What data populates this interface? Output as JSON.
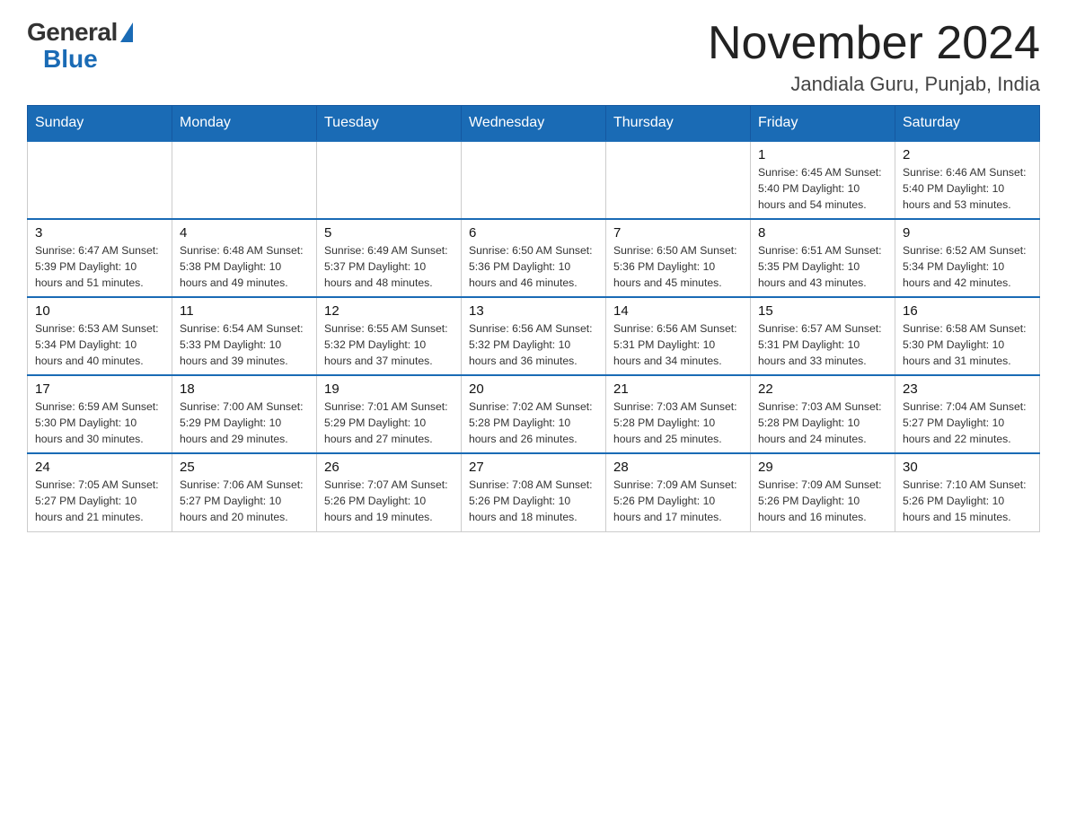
{
  "logo": {
    "general": "General",
    "blue": "Blue"
  },
  "title": "November 2024",
  "subtitle": "Jandiala Guru, Punjab, India",
  "weekdays": [
    "Sunday",
    "Monday",
    "Tuesday",
    "Wednesday",
    "Thursday",
    "Friday",
    "Saturday"
  ],
  "weeks": [
    [
      {
        "day": "",
        "info": ""
      },
      {
        "day": "",
        "info": ""
      },
      {
        "day": "",
        "info": ""
      },
      {
        "day": "",
        "info": ""
      },
      {
        "day": "",
        "info": ""
      },
      {
        "day": "1",
        "info": "Sunrise: 6:45 AM\nSunset: 5:40 PM\nDaylight: 10 hours\nand 54 minutes."
      },
      {
        "day": "2",
        "info": "Sunrise: 6:46 AM\nSunset: 5:40 PM\nDaylight: 10 hours\nand 53 minutes."
      }
    ],
    [
      {
        "day": "3",
        "info": "Sunrise: 6:47 AM\nSunset: 5:39 PM\nDaylight: 10 hours\nand 51 minutes."
      },
      {
        "day": "4",
        "info": "Sunrise: 6:48 AM\nSunset: 5:38 PM\nDaylight: 10 hours\nand 49 minutes."
      },
      {
        "day": "5",
        "info": "Sunrise: 6:49 AM\nSunset: 5:37 PM\nDaylight: 10 hours\nand 48 minutes."
      },
      {
        "day": "6",
        "info": "Sunrise: 6:50 AM\nSunset: 5:36 PM\nDaylight: 10 hours\nand 46 minutes."
      },
      {
        "day": "7",
        "info": "Sunrise: 6:50 AM\nSunset: 5:36 PM\nDaylight: 10 hours\nand 45 minutes."
      },
      {
        "day": "8",
        "info": "Sunrise: 6:51 AM\nSunset: 5:35 PM\nDaylight: 10 hours\nand 43 minutes."
      },
      {
        "day": "9",
        "info": "Sunrise: 6:52 AM\nSunset: 5:34 PM\nDaylight: 10 hours\nand 42 minutes."
      }
    ],
    [
      {
        "day": "10",
        "info": "Sunrise: 6:53 AM\nSunset: 5:34 PM\nDaylight: 10 hours\nand 40 minutes."
      },
      {
        "day": "11",
        "info": "Sunrise: 6:54 AM\nSunset: 5:33 PM\nDaylight: 10 hours\nand 39 minutes."
      },
      {
        "day": "12",
        "info": "Sunrise: 6:55 AM\nSunset: 5:32 PM\nDaylight: 10 hours\nand 37 minutes."
      },
      {
        "day": "13",
        "info": "Sunrise: 6:56 AM\nSunset: 5:32 PM\nDaylight: 10 hours\nand 36 minutes."
      },
      {
        "day": "14",
        "info": "Sunrise: 6:56 AM\nSunset: 5:31 PM\nDaylight: 10 hours\nand 34 minutes."
      },
      {
        "day": "15",
        "info": "Sunrise: 6:57 AM\nSunset: 5:31 PM\nDaylight: 10 hours\nand 33 minutes."
      },
      {
        "day": "16",
        "info": "Sunrise: 6:58 AM\nSunset: 5:30 PM\nDaylight: 10 hours\nand 31 minutes."
      }
    ],
    [
      {
        "day": "17",
        "info": "Sunrise: 6:59 AM\nSunset: 5:30 PM\nDaylight: 10 hours\nand 30 minutes."
      },
      {
        "day": "18",
        "info": "Sunrise: 7:00 AM\nSunset: 5:29 PM\nDaylight: 10 hours\nand 29 minutes."
      },
      {
        "day": "19",
        "info": "Sunrise: 7:01 AM\nSunset: 5:29 PM\nDaylight: 10 hours\nand 27 minutes."
      },
      {
        "day": "20",
        "info": "Sunrise: 7:02 AM\nSunset: 5:28 PM\nDaylight: 10 hours\nand 26 minutes."
      },
      {
        "day": "21",
        "info": "Sunrise: 7:03 AM\nSunset: 5:28 PM\nDaylight: 10 hours\nand 25 minutes."
      },
      {
        "day": "22",
        "info": "Sunrise: 7:03 AM\nSunset: 5:28 PM\nDaylight: 10 hours\nand 24 minutes."
      },
      {
        "day": "23",
        "info": "Sunrise: 7:04 AM\nSunset: 5:27 PM\nDaylight: 10 hours\nand 22 minutes."
      }
    ],
    [
      {
        "day": "24",
        "info": "Sunrise: 7:05 AM\nSunset: 5:27 PM\nDaylight: 10 hours\nand 21 minutes."
      },
      {
        "day": "25",
        "info": "Sunrise: 7:06 AM\nSunset: 5:27 PM\nDaylight: 10 hours\nand 20 minutes."
      },
      {
        "day": "26",
        "info": "Sunrise: 7:07 AM\nSunset: 5:26 PM\nDaylight: 10 hours\nand 19 minutes."
      },
      {
        "day": "27",
        "info": "Sunrise: 7:08 AM\nSunset: 5:26 PM\nDaylight: 10 hours\nand 18 minutes."
      },
      {
        "day": "28",
        "info": "Sunrise: 7:09 AM\nSunset: 5:26 PM\nDaylight: 10 hours\nand 17 minutes."
      },
      {
        "day": "29",
        "info": "Sunrise: 7:09 AM\nSunset: 5:26 PM\nDaylight: 10 hours\nand 16 minutes."
      },
      {
        "day": "30",
        "info": "Sunrise: 7:10 AM\nSunset: 5:26 PM\nDaylight: 10 hours\nand 15 minutes."
      }
    ]
  ]
}
